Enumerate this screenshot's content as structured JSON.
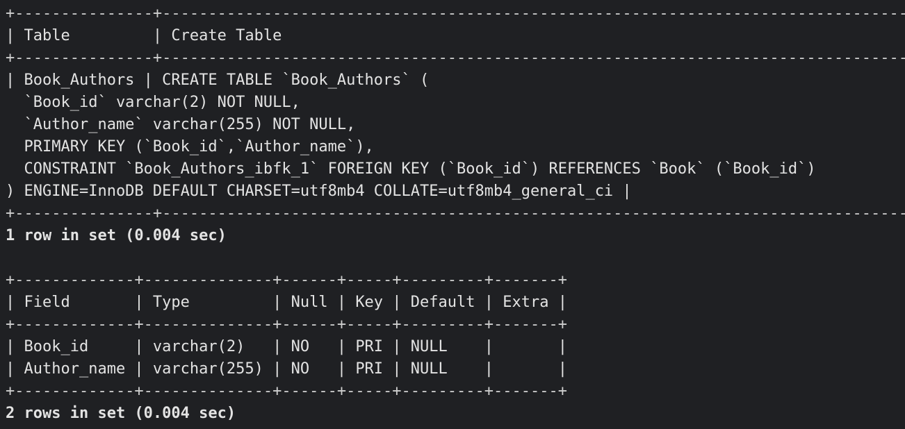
{
  "terminal": {
    "show_create": {
      "border_top": "+---------------+-----------------------------------------------------------------------------------------------------------------------------",
      "header": "| Table         | Create Table",
      "border_mid": "+---------------+-----------------------------------------------------------------------------------------------------------------------------",
      "rows": [
        "| Book_Authors | CREATE TABLE `Book_Authors` (",
        "  `Book_id` varchar(2) NOT NULL,",
        "  `Author_name` varchar(255) NOT NULL,",
        "  PRIMARY KEY (`Book_id`,`Author_name`),",
        "  CONSTRAINT `Book_Authors_ibfk_1` FOREIGN KEY (`Book_id`) REFERENCES `Book` (`Book_id`)",
        ") ENGINE=InnoDB DEFAULT CHARSET=utf8mb4 COLLATE=utf8mb4_general_ci |"
      ],
      "border_bottom": "+---------------+-----------------------------------------------------------------------------------------------------------------------------",
      "status": "1 row in set (0.004 sec)"
    },
    "describe": {
      "border_top": "+-------------+--------------+------+-----+---------+-------+",
      "header": "| Field       | Type         | Null | Key | Default | Extra |",
      "border_mid": "+-------------+--------------+------+-----+---------+-------+",
      "rows": [
        "| Book_id     | varchar(2)   | NO   | PRI | NULL    |       |",
        "| Author_name | varchar(255) | NO   | PRI | NULL    |       |"
      ],
      "border_bottom": "+-------------+--------------+------+-----+---------+-------+",
      "status": "2 rows in set (0.004 sec)"
    }
  }
}
